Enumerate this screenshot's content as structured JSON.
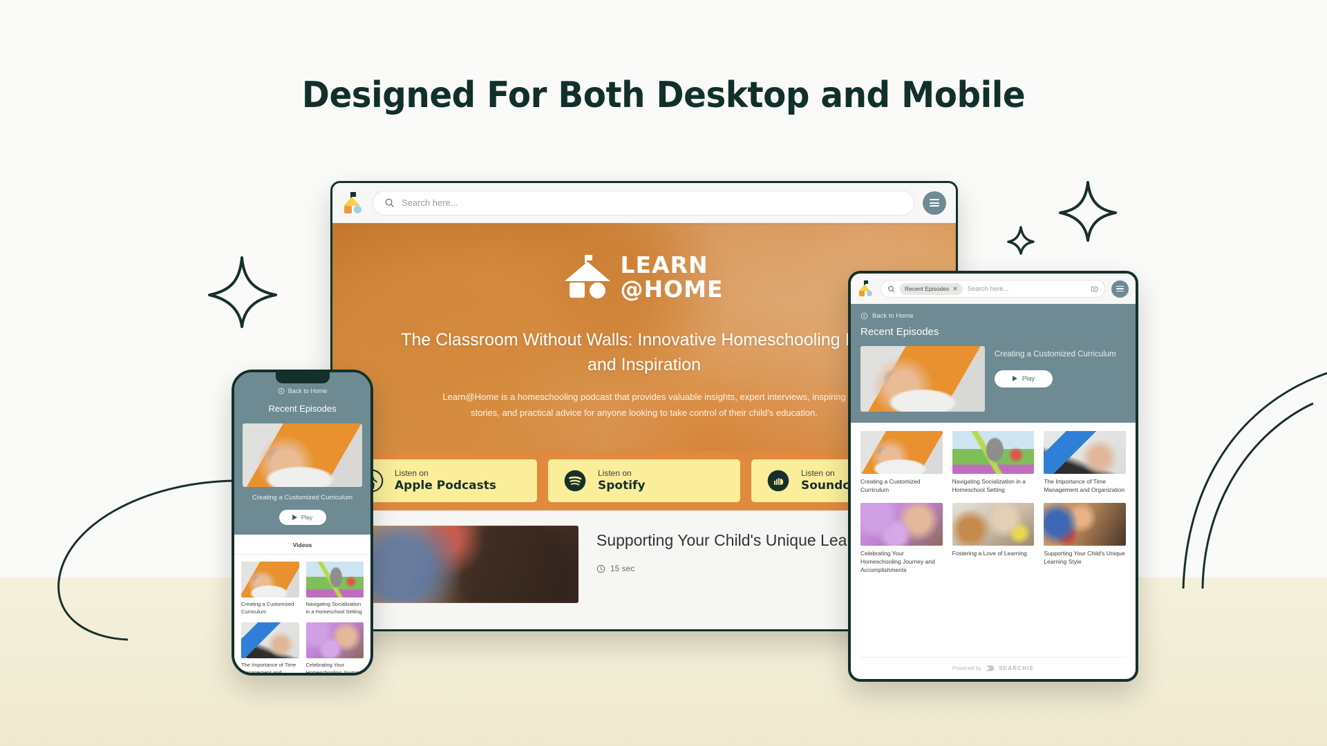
{
  "page": {
    "title": "Designed For Both Desktop and Mobile",
    "background_color": "#FAFAF8",
    "band_color": "#F3EED6",
    "title_color": "#11302B"
  },
  "brand": {
    "name_line1": "LEARN",
    "name_line2": "@HOME",
    "accent_orange": "#E0893F",
    "accent_yellow": "#FAEE9A",
    "accent_teal": "#6E8A92"
  },
  "desktop": {
    "search": {
      "placeholder": "Search here..."
    },
    "menu_label": "menu",
    "hero": {
      "headline": "The Classroom Without Walls: Innovative Homeschooling Ideas and Inspiration",
      "description": "Learn@Home is a homeschooling podcast that provides valuable insights, expert interviews, inspiring stories, and practical advice for anyone looking to take control of their child's education."
    },
    "podcast_buttons": [
      {
        "prefix": "Listen on",
        "platform": "Apple Podcasts",
        "icon": "apple-podcasts-icon"
      },
      {
        "prefix": "Listen on",
        "platform": "Spotify",
        "icon": "spotify-icon"
      },
      {
        "prefix": "Listen on",
        "platform": "Soundcloud",
        "icon": "soundcloud-icon"
      }
    ],
    "featured_episode": {
      "title": "Supporting Your Child's Unique Learning Style",
      "duration": "15 sec"
    }
  },
  "tablet": {
    "search": {
      "chip": "Recent Episodes",
      "chip_close": "✕",
      "placeholder": "Search here..."
    },
    "back_link": "Back to Home",
    "heading": "Recent Episodes",
    "featured": {
      "title": "Creating a Customized Curriculum",
      "play_label": "Play"
    },
    "videos": [
      {
        "title": "Creating a Customized Curriculum",
        "art": "th-curriculum"
      },
      {
        "title": "Navigating Socialization in a Homeschool Setting",
        "art": "th-socialization"
      },
      {
        "title": "The Importance of Time Management and Organization",
        "art": "th-time"
      },
      {
        "title": "Celebrating Your Homeschooling Journey and Accomplishments",
        "art": "th-celebrating"
      },
      {
        "title": "Fostering a Love of Learning",
        "art": "th-fostering"
      },
      {
        "title": "Supporting Your Child's Unique Learning Style",
        "art": "th-supporting"
      }
    ],
    "footer": {
      "powered_by": "Powered by",
      "vendor": "SEARCHIE"
    }
  },
  "phone": {
    "back_link": "Back to Home",
    "heading": "Recent Episodes",
    "featured": {
      "title": "Creating a Customized Curriculum",
      "play_label": "Play"
    },
    "tab": "Videos",
    "videos": [
      {
        "title": "Creating a Customized Curriculum",
        "art": "th-curriculum"
      },
      {
        "title": "Navigating Socialization in a Homeschool Setting",
        "art": "th-socialization"
      },
      {
        "title": "The Importance of Time Management and Organization",
        "art": "th-time"
      },
      {
        "title": "Celebrating Your Homeschooling Journey and Accomplishments",
        "art": "th-celebrating"
      }
    ]
  }
}
